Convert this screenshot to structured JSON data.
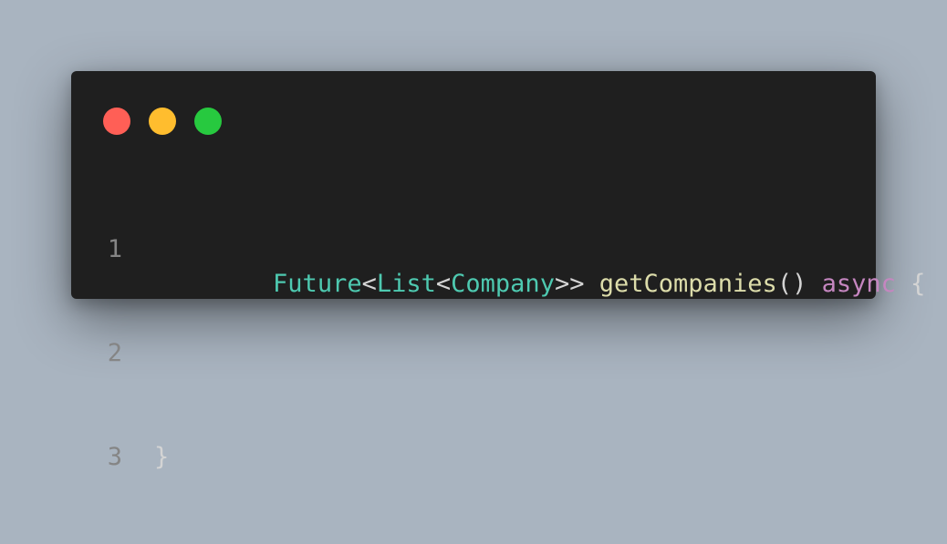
{
  "window": {
    "controls": [
      {
        "name": "close",
        "color": "#ff5f56"
      },
      {
        "name": "minimize",
        "color": "#ffbd2e"
      },
      {
        "name": "maximize",
        "color": "#27c93f"
      }
    ]
  },
  "colors": {
    "type": "#4ec9b0",
    "punct": "#d4d4d4",
    "function": "#dcdcaa",
    "keyword": "#c586c0",
    "line_number": "#858585",
    "background": "#1f1f1f",
    "page_background": "#a9b4c0"
  },
  "code": {
    "lines": [
      {
        "number": "1",
        "tokens": [
          {
            "t": "Future",
            "k": "type"
          },
          {
            "t": "<",
            "k": "punct"
          },
          {
            "t": "List",
            "k": "type"
          },
          {
            "t": "<",
            "k": "punct"
          },
          {
            "t": "Company",
            "k": "type"
          },
          {
            "t": ">> ",
            "k": "punct"
          },
          {
            "t": "getCompanies",
            "k": "function"
          },
          {
            "t": "() ",
            "k": "punct"
          },
          {
            "t": "async",
            "k": "keyword"
          },
          {
            "t": " {",
            "k": "punct"
          }
        ]
      },
      {
        "number": "2",
        "tokens": []
      },
      {
        "number": "3",
        "tokens": [
          {
            "t": "}",
            "k": "punct"
          }
        ]
      }
    ]
  }
}
